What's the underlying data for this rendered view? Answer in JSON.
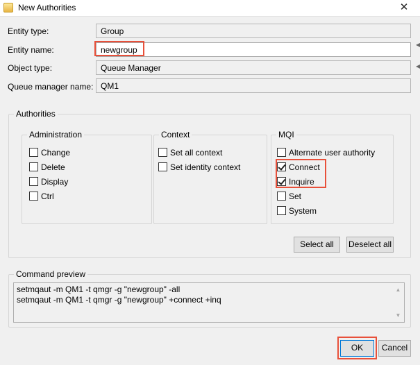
{
  "window": {
    "title": "New Authorities",
    "close_glyph": "✕"
  },
  "form": {
    "entity_type_label": "Entity type:",
    "entity_type_value": "Group",
    "entity_name_label": "Entity name:",
    "entity_name_value": "newgroup",
    "object_type_label": "Object type:",
    "object_type_value": "Queue Manager",
    "qm_name_label": "Queue manager name:",
    "qm_name_value": "QM1"
  },
  "authorities": {
    "title": "Authorities",
    "administration": {
      "title": "Administration",
      "items": [
        {
          "label": "Change",
          "checked": false
        },
        {
          "label": "Delete",
          "checked": false
        },
        {
          "label": "Display",
          "checked": false
        },
        {
          "label": "Ctrl",
          "checked": false
        }
      ]
    },
    "context": {
      "title": "Context",
      "items": [
        {
          "label": "Set all context",
          "checked": false
        },
        {
          "label": "Set identity context",
          "checked": false
        }
      ]
    },
    "mqi": {
      "title": "MQI",
      "items": [
        {
          "label": "Alternate user authority",
          "checked": false
        },
        {
          "label": "Connect",
          "checked": true
        },
        {
          "label": "Inquire",
          "checked": true
        },
        {
          "label": "Set",
          "checked": false
        },
        {
          "label": "System",
          "checked": false
        }
      ]
    },
    "select_all_label": "Select all",
    "deselect_all_label": "Deselect all"
  },
  "preview": {
    "title": "Command preview",
    "line1": "setmqaut -m QM1 -t qmgr -g \"newgroup\" -all",
    "line2": "setmqaut -m QM1 -t qmgr -g \"newgroup\" +connect +inq"
  },
  "footer": {
    "ok_label": "OK",
    "cancel_label": "Cancel"
  },
  "colors": {
    "highlight": "#e8503a",
    "dialog_bg": "#f0f0f0"
  }
}
